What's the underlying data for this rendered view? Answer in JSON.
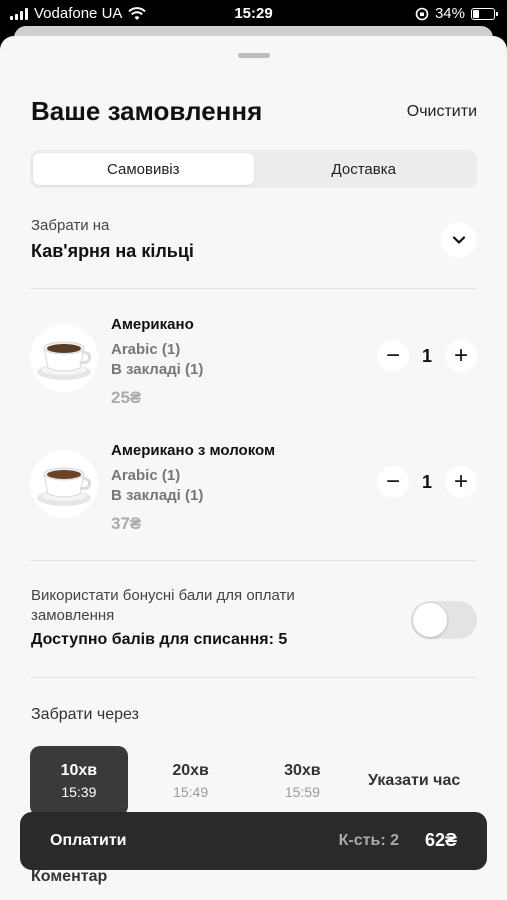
{
  "status_bar": {
    "carrier": "Vodafone UA",
    "time": "15:29",
    "battery": "34%"
  },
  "header": {
    "title": "Ваше замовлення",
    "clear_label": "Очистити"
  },
  "delivery_tabs": [
    {
      "label": "Самовивіз",
      "active": true
    },
    {
      "label": "Доставка",
      "active": false
    }
  ],
  "pickup": {
    "label": "Забрати на",
    "place": "Кав'ярня на кільці"
  },
  "items": [
    {
      "name": "Американо",
      "option_1": "Arabic (1)",
      "option_2": "В закладі (1)",
      "price": "25₴",
      "quantity": "1",
      "minus": "−",
      "plus": "+"
    },
    {
      "name": "Американо з молоком",
      "option_1": "Arabic (1)",
      "option_2": "В закладі (1)",
      "price": "37₴",
      "quantity": "1",
      "minus": "−",
      "plus": "+"
    }
  ],
  "bonus": {
    "text": "Використати бонусні бали для оплати замовлення",
    "available": "Доступно балів для списання: 5",
    "enabled": false
  },
  "pickup_time": {
    "label": "Забрати через",
    "options": [
      {
        "line1": "10хв",
        "line2": "15:39",
        "active": true
      },
      {
        "line1": "20хв",
        "line2": "15:49",
        "active": false
      },
      {
        "line1": "30хв",
        "line2": "15:59",
        "active": false
      },
      {
        "line1": "Указати час",
        "line2": "",
        "active": false
      }
    ]
  },
  "comment_label": "Коментар",
  "pay_bar": {
    "label": "Оплатити",
    "count": "К-сть: 2",
    "total": "62₴"
  },
  "colors": {
    "sheet_bg": "#f7f7f7",
    "active_time": "#3a3a3a",
    "pay_bar": "#2a2a2a"
  }
}
